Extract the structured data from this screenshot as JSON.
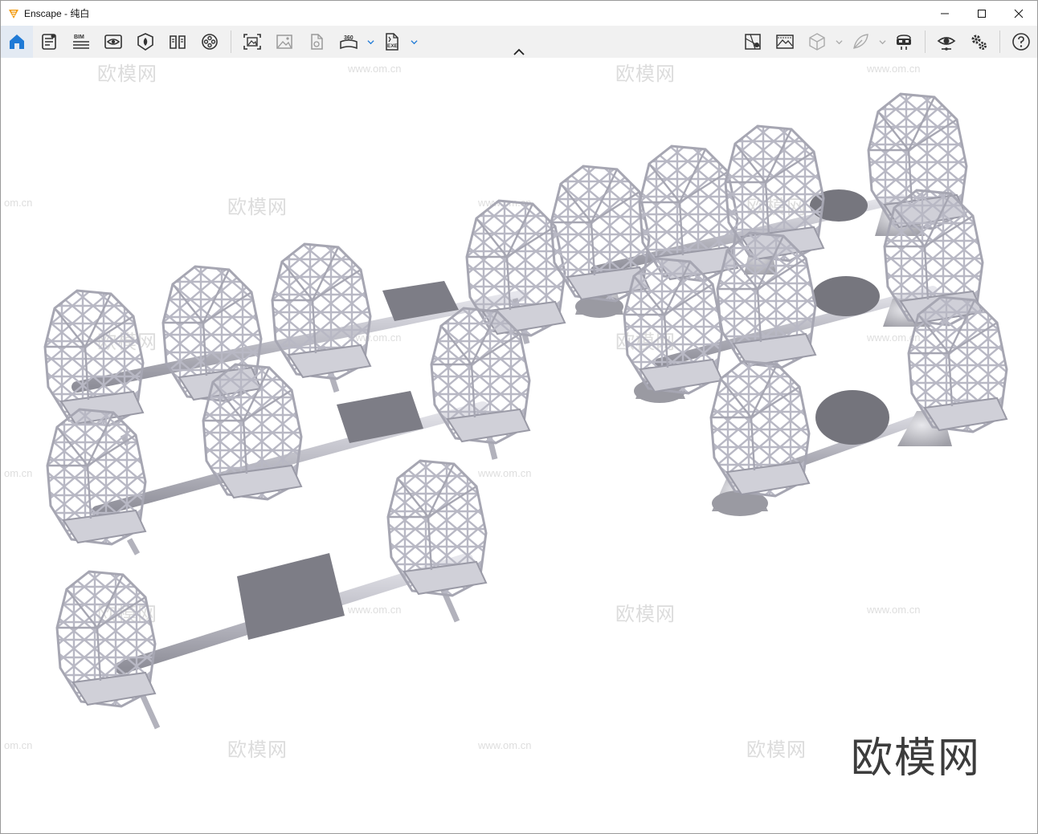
{
  "window": {
    "app_name": "Enscape",
    "title": "Enscape - 纯白",
    "accent_color": "#f39c12"
  },
  "toolbar": {
    "left_icons": [
      "home-icon",
      "settings-sheet-icon",
      "bim-icon",
      "view-eye-icon",
      "asset-library-icon",
      "book-icon",
      "video-reel-icon"
    ],
    "mid_icons": [
      "screenshot-icon",
      "image-icon",
      "render-file-icon",
      "panorama-360-icon",
      "exe-export-icon"
    ],
    "bim_label": "BIM",
    "pano_label": "360",
    "exe_label": "EXE",
    "right_icons": [
      "map-icon",
      "image-overlay-icon",
      "cube-icon",
      "feather-icon",
      "vr-headset-icon",
      "visibility-icon",
      "gears-icon",
      "help-icon"
    ],
    "active_color": "#1f7ad6"
  },
  "viewport": {
    "watermark_text": "欧模网",
    "watermark_url": "www.om.cn",
    "watermark_url_short": "om.cn",
    "logo_text": "欧模网"
  }
}
